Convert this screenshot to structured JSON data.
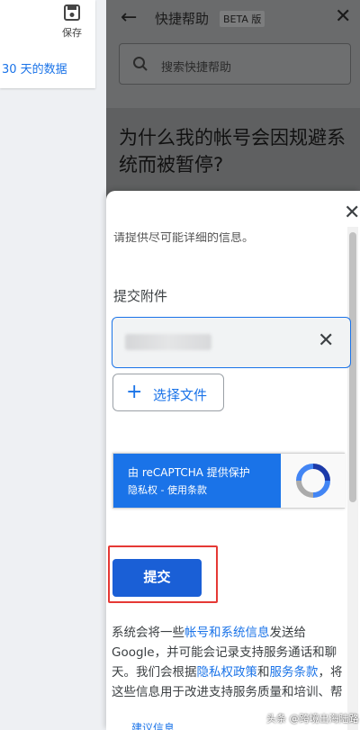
{
  "toolbar": {
    "save_label": "保存",
    "date_range": "30 天的数据"
  },
  "help": {
    "title": "快捷帮助",
    "beta_badge": "BETA 版",
    "search_placeholder": "搜索快捷帮助",
    "article_title": "为什么我的帐号会因规避系统而被暂停?"
  },
  "form": {
    "clipped_text": "请提供尽可能详细的信息。",
    "attach_label": "提交附件",
    "choose_file_label": "选择文件",
    "captcha_title": "由 reCAPTCHA 提供保护",
    "captcha_links": "隐私权 - 使用条款",
    "submit_label": "提交"
  },
  "notice": {
    "p1": "系统会将一些",
    "link1": "帐号和系统信息",
    "p2": "发送给 Google，并可能会记录支持服务通话和聊天。我们会根据",
    "link2": "隐私权政策",
    "p3": "和",
    "link3": "服务条款",
    "p4": "，将这些信息用于改进支持服务质量和培训、帮",
    "footer_link": "建议信息"
  },
  "watermark": "头条 @跨境出海陆路",
  "colors": {
    "accent": "#1a73e8",
    "submit": "#1a5fd6",
    "highlight": "#e53935"
  }
}
